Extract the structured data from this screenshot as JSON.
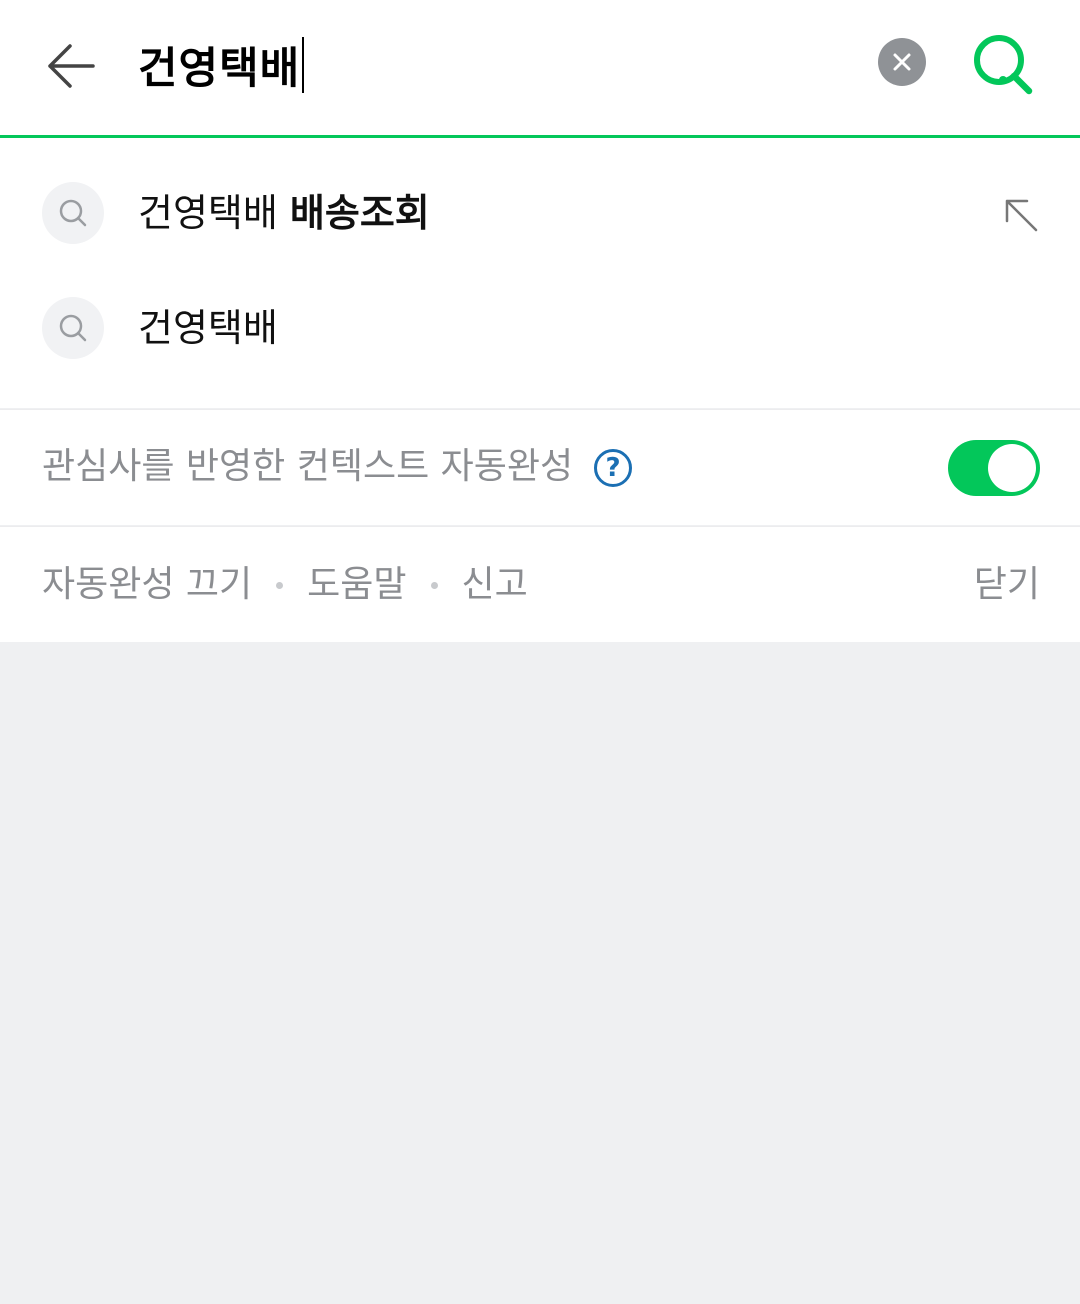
{
  "search": {
    "query": "건영택배"
  },
  "suggestions": [
    {
      "plain": "건영택배 ",
      "bold": "배송조회"
    },
    {
      "plain": "건영택배",
      "bold": ""
    }
  ],
  "context": {
    "label": "관심사를 반영한 컨텍스트 자동완성",
    "help_glyph": "?",
    "toggle_on": true
  },
  "footer": {
    "links": [
      "자동완성 끄기",
      "도움말",
      "신고"
    ],
    "close_label": "닫기"
  },
  "colors": {
    "accent": "#03c75a",
    "help_blue": "#1b6fb3",
    "muted_text": "#8b8d91",
    "background": "#eff0f2"
  },
  "icons": [
    "back-arrow-icon",
    "clear-icon",
    "search-icon",
    "arrow-up-left-icon",
    "help-icon"
  ]
}
